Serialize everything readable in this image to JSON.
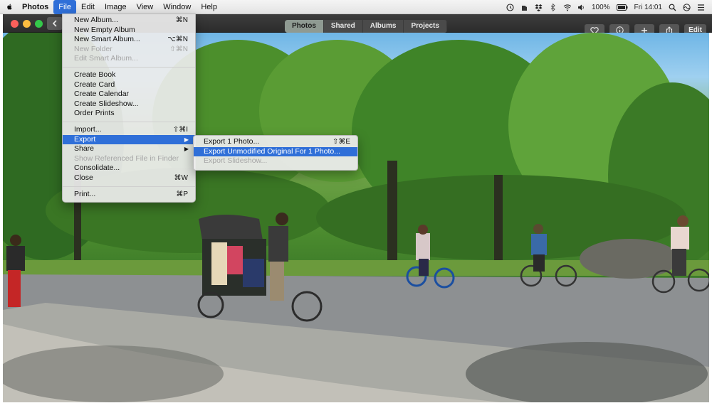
{
  "menubar": {
    "app_name": "Photos",
    "items": [
      "File",
      "Edit",
      "Image",
      "View",
      "Window",
      "Help"
    ],
    "status": {
      "battery": "100%",
      "clock": "Fri 14:01"
    }
  },
  "toolbar": {
    "tabs": [
      "Photos",
      "Shared",
      "Albums",
      "Projects"
    ],
    "edit_label": "Edit"
  },
  "file_menu": {
    "items": [
      {
        "label": "New Album...",
        "shortcut": "⌘N"
      },
      {
        "label": "New Empty Album",
        "shortcut": ""
      },
      {
        "label": "New Smart Album...",
        "shortcut": "⌥⌘N"
      },
      {
        "label": "New Folder",
        "shortcut": "⇧⌘N"
      },
      {
        "label": "Edit Smart Album...",
        "shortcut": ""
      },
      {
        "label": "Create Book",
        "shortcut": ""
      },
      {
        "label": "Create Card",
        "shortcut": ""
      },
      {
        "label": "Create Calendar",
        "shortcut": ""
      },
      {
        "label": "Create Slideshow...",
        "shortcut": ""
      },
      {
        "label": "Order Prints",
        "shortcut": ""
      },
      {
        "label": "Import...",
        "shortcut": "⇧⌘I"
      },
      {
        "label": "Export",
        "shortcut": ""
      },
      {
        "label": "Share",
        "shortcut": ""
      },
      {
        "label": "Show Referenced File in Finder",
        "shortcut": ""
      },
      {
        "label": "Consolidate...",
        "shortcut": ""
      },
      {
        "label": "Close",
        "shortcut": "⌘W"
      },
      {
        "label": "Print...",
        "shortcut": "⌘P"
      }
    ]
  },
  "export_submenu": {
    "items": [
      {
        "label": "Export 1 Photo...",
        "shortcut": "⇧⌘E"
      },
      {
        "label": "Export Unmodified Original For 1 Photo...",
        "shortcut": ""
      },
      {
        "label": "Export Slideshow...",
        "shortcut": ""
      }
    ]
  },
  "colors": {
    "highlight": "#2f6fd8",
    "toolbar": "#2c2c2c"
  }
}
